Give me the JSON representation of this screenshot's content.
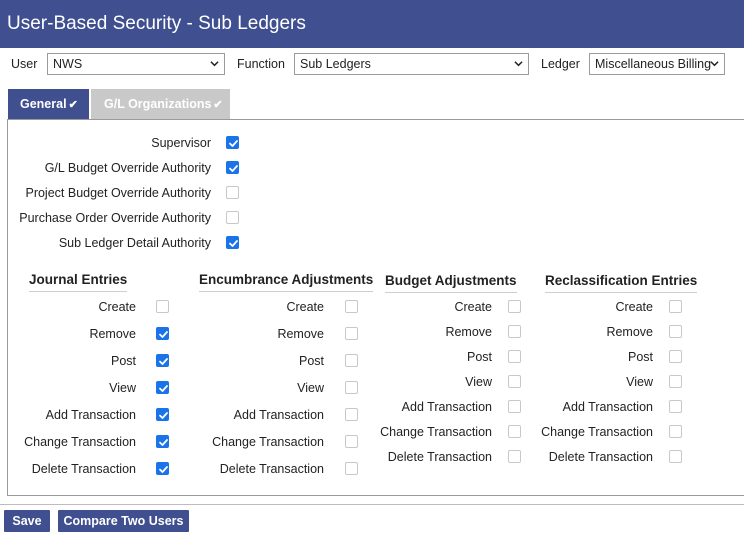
{
  "title": "User-Based Security - Sub Ledgers",
  "filters": {
    "user_label": "User",
    "user_value": "NWS",
    "function_label": "Function",
    "function_value": "Sub Ledgers",
    "ledger_label": "Ledger",
    "ledger_value": "Miscellaneous Billing"
  },
  "tabs": [
    {
      "label": "General",
      "active": true
    },
    {
      "label": "G/L Organizations",
      "active": false
    }
  ],
  "authorities": [
    {
      "label": "Supervisor",
      "checked": true
    },
    {
      "label": "G/L Budget Override Authority",
      "checked": true
    },
    {
      "label": "Project Budget Override Authority",
      "checked": false
    },
    {
      "label": "Purchase Order Override Authority",
      "checked": false
    },
    {
      "label": "Sub Ledger Detail Authority",
      "checked": true
    }
  ],
  "groups": [
    {
      "title": "Journal Entries",
      "items": [
        {
          "label": "Create",
          "checked": false
        },
        {
          "label": "Remove",
          "checked": true
        },
        {
          "label": "Post",
          "checked": true
        },
        {
          "label": "View",
          "checked": true
        },
        {
          "label": "Add Transaction",
          "checked": true
        },
        {
          "label": "Change Transaction",
          "checked": true
        },
        {
          "label": "Delete Transaction",
          "checked": true
        }
      ]
    },
    {
      "title": "Encumbrance Adjustments",
      "items": [
        {
          "label": "Create",
          "checked": false
        },
        {
          "label": "Remove",
          "checked": false
        },
        {
          "label": "Post",
          "checked": false
        },
        {
          "label": "View",
          "checked": false
        },
        {
          "label": "Add Transaction",
          "checked": false
        },
        {
          "label": "Change Transaction",
          "checked": false
        },
        {
          "label": "Delete Transaction",
          "checked": false
        }
      ]
    },
    {
      "title": "Budget Adjustments",
      "items": [
        {
          "label": "Create",
          "checked": false
        },
        {
          "label": "Remove",
          "checked": false
        },
        {
          "label": "Post",
          "checked": false
        },
        {
          "label": "View",
          "checked": false
        },
        {
          "label": "Add Transaction",
          "checked": false
        },
        {
          "label": "Change Transaction",
          "checked": false
        },
        {
          "label": "Delete Transaction",
          "checked": false
        }
      ]
    },
    {
      "title": "Reclassification Entries",
      "items": [
        {
          "label": "Create",
          "checked": false
        },
        {
          "label": "Remove",
          "checked": false
        },
        {
          "label": "Post",
          "checked": false
        },
        {
          "label": "View",
          "checked": false
        },
        {
          "label": "Add Transaction",
          "checked": false
        },
        {
          "label": "Change Transaction",
          "checked": false
        },
        {
          "label": "Delete Transaction",
          "checked": false
        }
      ]
    }
  ],
  "buttons": {
    "save": "Save",
    "compare": "Compare Two Users"
  }
}
